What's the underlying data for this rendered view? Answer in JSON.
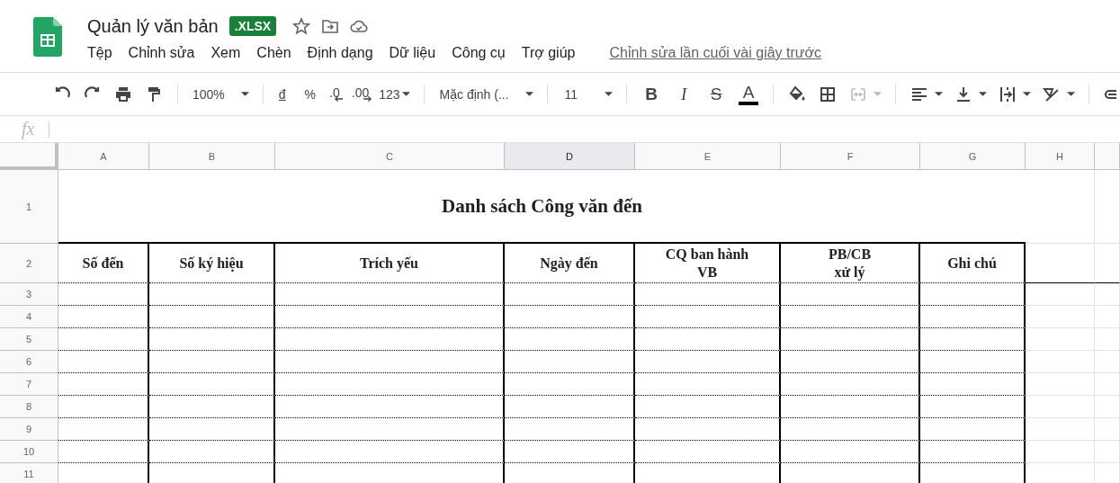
{
  "document": {
    "title": "Quản lý văn bản",
    "format_badge": ".XLSX",
    "last_edit": "Chỉnh sửa lần cuối vài giây trước"
  },
  "menu": [
    "Tệp",
    "Chỉnh sửa",
    "Xem",
    "Chèn",
    "Định dạng",
    "Dữ liệu",
    "Công cụ",
    "Trợ giúp"
  ],
  "toolbar": {
    "zoom": "100%",
    "currency": "đ",
    "percent": "%",
    "decrease_decimals": ".0",
    "increase_decimals": ".00",
    "number_format": "123",
    "font": "Mặc định (...",
    "font_size": "11",
    "bold": "B",
    "italic": "I",
    "strikethrough": "S",
    "text_color": "A"
  },
  "formula_bar": {
    "label": "fx"
  },
  "sheet": {
    "columns": [
      {
        "label": "A",
        "selected": false
      },
      {
        "label": "B",
        "selected": false
      },
      {
        "label": "C",
        "selected": false
      },
      {
        "label": "D",
        "selected": true
      },
      {
        "label": "E",
        "selected": false
      },
      {
        "label": "F",
        "selected": false
      },
      {
        "label": "G",
        "selected": false
      },
      {
        "label": "H",
        "selected": false
      }
    ],
    "title_row": {
      "number": "1",
      "title": "Danh sách Công văn đến"
    },
    "header_row": {
      "number": "2",
      "cells": [
        "Số đến",
        "Số ký hiệu",
        "Trích yếu",
        "Ngày đến",
        "CQ ban hành\nVB",
        "PB/CB\nxử lý",
        "Ghi chú"
      ]
    },
    "empty_rows": [
      "3",
      "4",
      "5",
      "6",
      "7",
      "8",
      "9",
      "10",
      "11"
    ]
  }
}
